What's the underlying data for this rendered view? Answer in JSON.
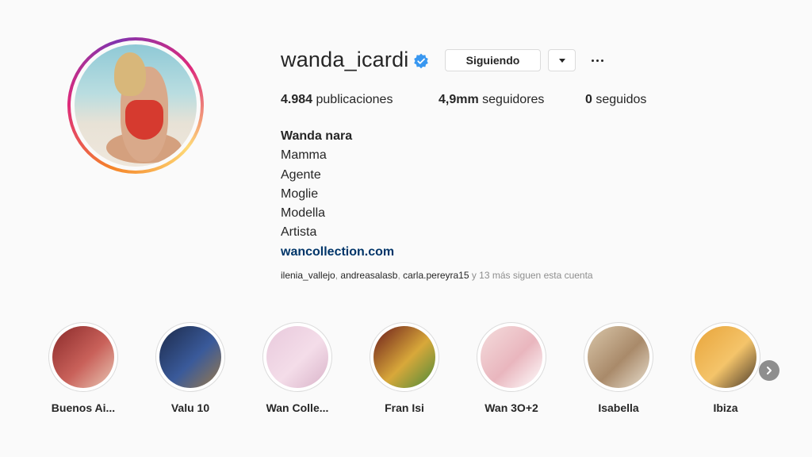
{
  "profile": {
    "username": "wanda_icardi",
    "verified_icon": "verified-badge-icon",
    "following_label": "Siguiendo",
    "dropdown_icon": "chevron-down-icon",
    "more_icon": "more-options-icon"
  },
  "stats": {
    "posts_count": "4.984",
    "posts_label": "publicaciones",
    "followers_count": "4,9mm",
    "followers_label": "seguidores",
    "following_count": "0",
    "following_label": "seguidos"
  },
  "bio": {
    "name": "Wanda nara",
    "lines": [
      "Mamma",
      "Agente",
      "Moglie",
      "Modella",
      "Artista"
    ],
    "website": "wancollection.com"
  },
  "followed_by": {
    "accounts": [
      "ilenia_vallejo",
      "andreasalasb",
      "carla.pereyra15"
    ],
    "suffix": " y 13 más siguen esta cuenta"
  },
  "highlights": [
    {
      "label": "Buenos Ai...",
      "colors": [
        "#8a2a2a",
        "#c9615a",
        "#e9c9b6"
      ]
    },
    {
      "label": "Valu 10",
      "colors": [
        "#1c2a4a",
        "#3a5a9a",
        "#9a7a4a"
      ]
    },
    {
      "label": "Wan Colle...",
      "colors": [
        "#e8c9dc",
        "#f4dde9",
        "#d9b3c9"
      ]
    },
    {
      "label": "Fran Isi",
      "colors": [
        "#6a1a1a",
        "#d8a83a",
        "#4a8a3a"
      ]
    },
    {
      "label": "Wan 3O+2",
      "colors": [
        "#f4dcdc",
        "#e9b6be",
        "#ffffff"
      ]
    },
    {
      "label": "Isabella",
      "colors": [
        "#d9c6a9",
        "#a98a6a",
        "#e9e0d0"
      ]
    },
    {
      "label": "Ibiza",
      "colors": [
        "#e8a43a",
        "#f4c46a",
        "#4a3a2a"
      ]
    }
  ],
  "next_icon": "chevron-right-icon",
  "colors": {
    "link": "#003569",
    "verified": "#3897f0",
    "muted": "#8e8e8e"
  }
}
